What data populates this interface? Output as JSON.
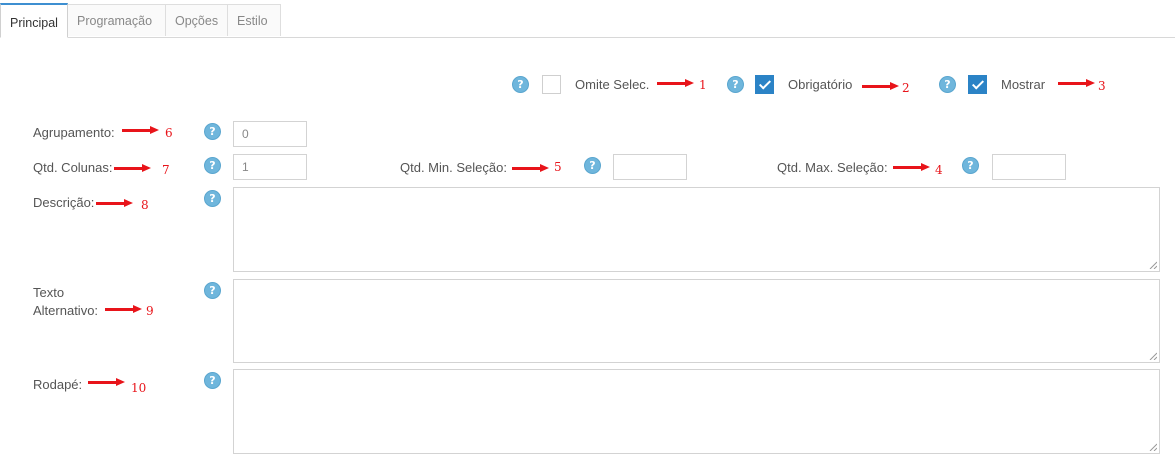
{
  "tabs": [
    {
      "label": "Principal",
      "active": true
    },
    {
      "label": "Programação",
      "active": false
    },
    {
      "label": "Opções",
      "active": false
    },
    {
      "label": "Estilo",
      "active": false
    }
  ],
  "help_icon_glyph": "?",
  "options": {
    "omite_selec": {
      "label": "Omite Selec.",
      "checked": false,
      "marker": "1"
    },
    "obrigatorio": {
      "label": "Obrigatório",
      "checked": true,
      "marker": "2"
    },
    "mostrar": {
      "label": "Mostrar",
      "checked": true,
      "marker": "3"
    }
  },
  "fields": {
    "agrupamento": {
      "label": "Agrupamento:",
      "value": "0",
      "marker": "6"
    },
    "qtd_colunas": {
      "label": "Qtd. Colunas:",
      "value": "1",
      "marker": "7"
    },
    "qtd_min_selecao": {
      "label": "Qtd. Min. Seleção:",
      "value": "",
      "marker": "5"
    },
    "qtd_max_selecao": {
      "label": "Qtd. Max. Seleção:",
      "value": "",
      "marker": "4"
    },
    "descricao": {
      "label": "Descrição:",
      "value": "",
      "marker": "8"
    },
    "texto_alternativo": {
      "label_line1": "Texto",
      "label_line2": "Alternativo:",
      "value": "",
      "marker": "9"
    },
    "rodape": {
      "label": "Rodapé:",
      "value": "",
      "marker": "10"
    }
  },
  "colors": {
    "accent": "#2b83c6",
    "help_icon": "#6fb6dc",
    "annotation": "#e8141a"
  }
}
